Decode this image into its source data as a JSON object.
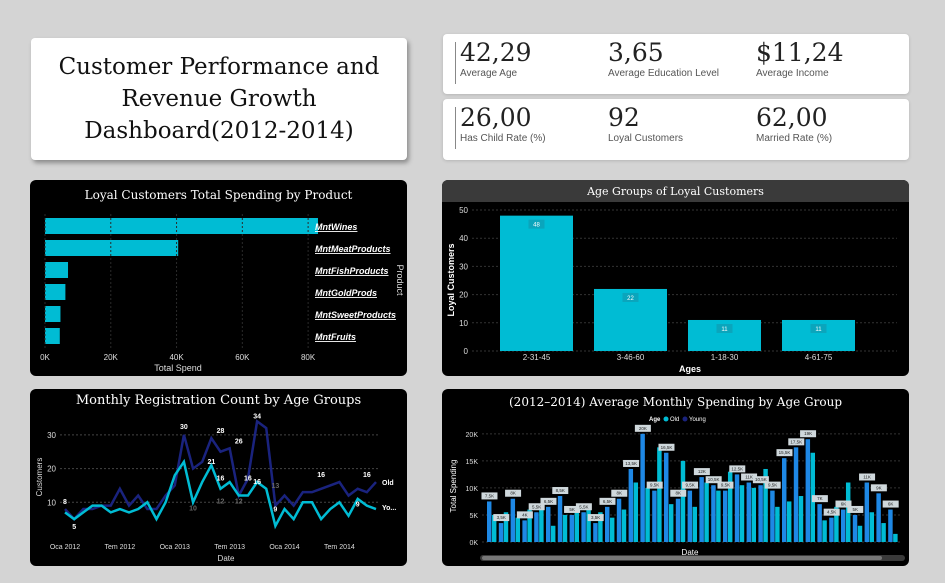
{
  "title": "Customer Performance and Revenue Growth Dashboard(2012-2014)",
  "kpis_row1": [
    {
      "value": "42,29",
      "label": "Average Age"
    },
    {
      "value": "3,65",
      "label": "Average Education Level"
    },
    {
      "value": "$11,24",
      "label": "Average Income"
    }
  ],
  "kpis_row2": [
    {
      "value": "26,00",
      "label": "Has Child Rate (%)"
    },
    {
      "value": "92",
      "label": "Loyal Customers"
    },
    {
      "value": "62,00",
      "label": "Married Rate (%)"
    }
  ],
  "colors": {
    "accent": "#00bcd4",
    "dark_series": "#1a237e",
    "mid_series": "#1e88e5",
    "panel_bg": "#000000"
  },
  "chart_data": [
    {
      "type": "bar",
      "orientation": "horizontal",
      "title": "Loyal Customers Total Spending by Product",
      "xlabel": "Total Spend",
      "ylabel": "Product",
      "categories": [
        "MntWines",
        "MntMeatProducts",
        "MntFishProducts",
        "MntGoldProds",
        "MntSweetProducts",
        "MntFruits"
      ],
      "values": [
        83000,
        40500,
        7000,
        6200,
        4700,
        4500
      ],
      "xlim": [
        0,
        90000
      ],
      "xticks": [
        "0K",
        "20K",
        "40K",
        "60K",
        "80K"
      ]
    },
    {
      "type": "bar",
      "title": "Age Groups of Loyal Customers",
      "xlabel": "Ages",
      "ylabel": "Loyal Customers",
      "categories": [
        "2-31-45",
        "3-46-60",
        "1-18-30",
        "4-61-75"
      ],
      "values": [
        48,
        22,
        11,
        11
      ],
      "ylim": [
        0,
        50
      ],
      "yticks": [
        0,
        10,
        20,
        30,
        40,
        50
      ]
    },
    {
      "type": "line",
      "title": "Monthly Registration Count by Age Groups",
      "xlabel": "Date",
      "ylabel": "Customers",
      "xticks": [
        "Oca 2012",
        "Tem 2012",
        "Oca 2013",
        "Tem 2013",
        "Oca 2014",
        "Tem 2014"
      ],
      "ylim": [
        0,
        35
      ],
      "yticks": [
        10,
        20,
        30
      ],
      "series": [
        {
          "name": "Old",
          "values": [
            8,
            5,
            8,
            8,
            9,
            9,
            14,
            9,
            12,
            8,
            8,
            12,
            15,
            30,
            20,
            22,
            29,
            25,
            26,
            12,
            17,
            34,
            32,
            9,
            12,
            9,
            13,
            13,
            14,
            15,
            16,
            12,
            14,
            13,
            16
          ]
        },
        {
          "name": "Young",
          "values": [
            7,
            5,
            7,
            9,
            9,
            7,
            8,
            7,
            8,
            10,
            5,
            10,
            18,
            22,
            10,
            16,
            21,
            14,
            16,
            12,
            12,
            16,
            14,
            3,
            8,
            5,
            10,
            10,
            5,
            8,
            10,
            6,
            11,
            9,
            8
          ]
        }
      ],
      "data_labels": [
        "8",
        "5",
        "30",
        "21",
        "28",
        "16",
        "26",
        "16",
        "34",
        "16",
        "13",
        "9",
        "12",
        "10",
        "12",
        "16",
        "9",
        "16",
        "Old",
        "Yo..."
      ]
    },
    {
      "type": "bar",
      "title": "(2012–2014) Average Monthly Spending by Age Group",
      "xlabel": "Date",
      "ylabel": "Total Spending",
      "legend_title": "Age",
      "legend_items": [
        "Old",
        "Young"
      ],
      "legend_position": "top",
      "ylim": [
        0,
        22000
      ],
      "yticks": [
        "0K",
        "5K",
        "10K",
        "15K",
        "20K"
      ],
      "series": [
        {
          "name": "Old",
          "values": [
            7500,
            3500,
            8000,
            4000,
            5500,
            6500,
            8500,
            5000,
            5500,
            3500,
            6500,
            8000,
            13500,
            20000,
            9500,
            16500,
            8000,
            9500,
            12000,
            10500,
            9500,
            12500,
            11000,
            10500,
            9500,
            15500,
            17500,
            19000,
            7000,
            4500,
            6000,
            5000,
            11000,
            9000,
            6000
          ]
        },
        {
          "name": "Young",
          "values": [
            5000,
            5500,
            4500,
            6000,
            7000,
            3000,
            5000,
            6000,
            6500,
            5500,
            4500,
            6000,
            11000,
            10000,
            17500,
            7000,
            15000,
            6500,
            11000,
            9500,
            13000,
            10500,
            10000,
            13500,
            6500,
            7500,
            8500,
            16500,
            4000,
            6500,
            11000,
            3000,
            5500,
            3500,
            1500
          ]
        }
      ],
      "data_labels": [
        "7,5K",
        "3,5K",
        "8K",
        "4K",
        "5,5K",
        "6,5K",
        "8,5K",
        "5K",
        "5,5K",
        "3,5K",
        "6,5K",
        "8K",
        "13,5K",
        "20K",
        "9,5K",
        "16,5K",
        "8K",
        "9,5K",
        "12K",
        "10,5K",
        "9,5K",
        "12,5K",
        "11K",
        "10,5K",
        "9,5K",
        "15,5K",
        "17,5K",
        "19K",
        "7K",
        "4,5K",
        "6K",
        "5K",
        "11K",
        "9K",
        "6K"
      ]
    }
  ]
}
